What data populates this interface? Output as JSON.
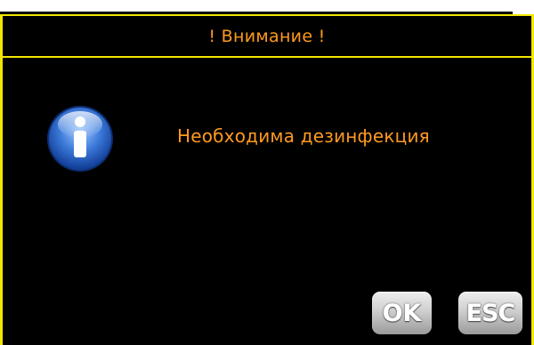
{
  "dialog": {
    "title": "! Внимание !",
    "message": "Необходима дезинфекция",
    "icon": "info-icon",
    "buttons": {
      "ok_label": "OK",
      "esc_label": "ESC"
    }
  },
  "colors": {
    "border": "#f2e600",
    "text": "#ff9a1f",
    "background": "#000000"
  }
}
